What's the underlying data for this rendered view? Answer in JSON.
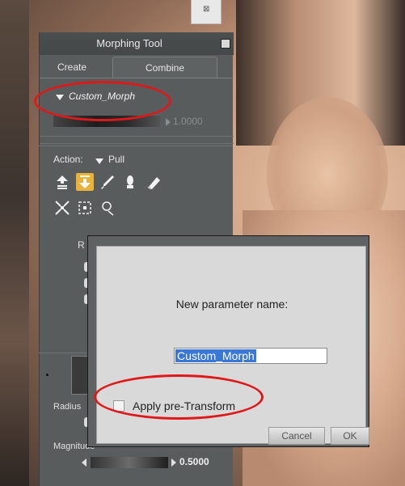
{
  "close_tab": {
    "glyph": "⊠"
  },
  "panel": {
    "title": "Morphing Tool",
    "tabs": [
      "Create",
      "Combine"
    ],
    "morph_name": "Custom_Morph",
    "morph_value": "1.0000",
    "action_label": "Action:",
    "action_value": "Pull",
    "tools": [
      "push-icon",
      "pull-icon",
      "brush-icon",
      "sculpt-icon",
      "eraser-icon",
      "shrink-icon",
      "frame-icon",
      "lasso-icon"
    ],
    "active_tool": "pull-icon",
    "truncated_label": "R",
    "radius_label": "Radius",
    "magnitude_label": "Magnitude",
    "magnitude_value": "0.5000"
  },
  "dialog": {
    "prompt": "New parameter name:",
    "input_value": "Custom_Morph",
    "checkbox_label": "Apply pre-Transform",
    "checkbox_checked": false,
    "cancel_label": "Cancel",
    "ok_label": "OK"
  },
  "annotations": {
    "highlight_color": "#e0181a"
  },
  "colors": {
    "panel_bg": "#585c5c",
    "dialog_bg": "#d9d9d9",
    "active_tool": "#e9b338",
    "selection": "#3a78d8"
  }
}
